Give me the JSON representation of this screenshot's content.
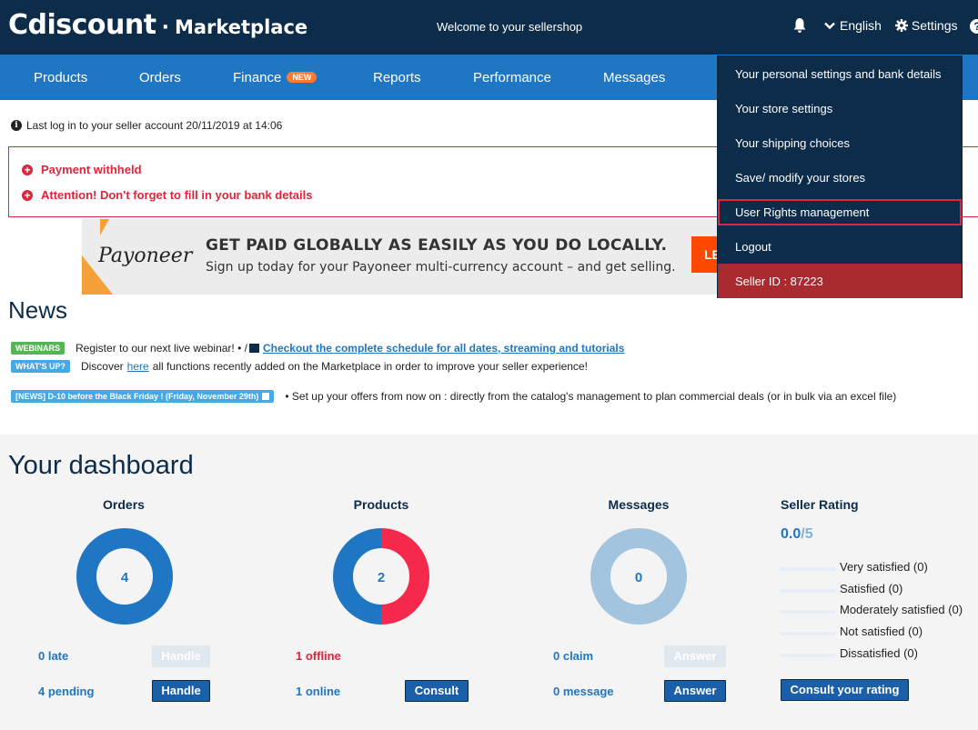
{
  "header": {
    "brand": "Cdiscount",
    "separator": "·",
    "marketplace": "Marketplace",
    "welcome": "Welcome to your sellershop",
    "language": "English",
    "settings": "Settings",
    "help": "?"
  },
  "nav": {
    "products": "Products",
    "orders": "Orders",
    "finance": "Finance",
    "finance_badge": "NEW",
    "reports": "Reports",
    "performance": "Performance",
    "messages": "Messages"
  },
  "lastlog": "Last log in to your seller account 20/11/2019 at 14:06",
  "alerts": {
    "payment": "Payment withheld",
    "bank": "Attention! Don't forget to fill in your bank details"
  },
  "banner": {
    "logo": "Payoneer",
    "title": "GET PAID GLOBALLY AS EASILY AS YOU DO LOCALLY.",
    "subtitle": "Sign up today for your Payoneer multi-currency account – and get selling.",
    "button": "LE"
  },
  "news": {
    "title": "News",
    "line1_tag": "WEBINARS",
    "line1_text": "Register to our next live webinar! • /",
    "line1_link": "Checkout the complete schedule for all dates, streaming and tutorials",
    "line2_tag": "WHAT'S UP?",
    "line2_pre": "Discover",
    "line2_link": "here",
    "line2_post": "all functions recently added on the Marketplace in order to improve your seller experience!",
    "line3_tag": "[NEWS] D-10 before the Black Friday ! (Friday, November 29th)",
    "line3_text": "• Set up your offers from now on : directly from the catalog's management to plan commercial deals (or in bulk via an excel file)"
  },
  "dashboard": {
    "title": "Your dashboard",
    "orders": {
      "title": "Orders",
      "count": "4",
      "late": "0 late",
      "pending": "4 pending",
      "btn_late": "Handle",
      "btn_pending": "Handle"
    },
    "products": {
      "title": "Products",
      "count": "2",
      "offline": "1 offline",
      "online": "1 online",
      "btn_online": "Consult"
    },
    "messages": {
      "title": "Messages",
      "count": "0",
      "claim": "0 claim",
      "message": "0 message",
      "btn_claim": "Answer",
      "btn_message": "Answer"
    },
    "rating": {
      "title": "Seller Rating",
      "score": "0.0",
      "denominator": "/5",
      "rows": [
        "Very satisfied (0)",
        "Satisfied (0)",
        "Moderately satisfied (0)",
        "Not satisfied (0)",
        "Dissatisfied (0)"
      ],
      "button": "Consult your rating"
    }
  },
  "dropdown": {
    "items": [
      "Your personal settings and bank details",
      "Your store settings",
      "Your shipping choices",
      "Save/ modify your stores",
      "User Rights management",
      "Logout",
      "Seller ID : 87223"
    ]
  },
  "colors": {
    "navy": "#0c2c4a",
    "blue": "#1f76c2",
    "red": "#e0243c",
    "donut_light": "#a3c4de"
  }
}
